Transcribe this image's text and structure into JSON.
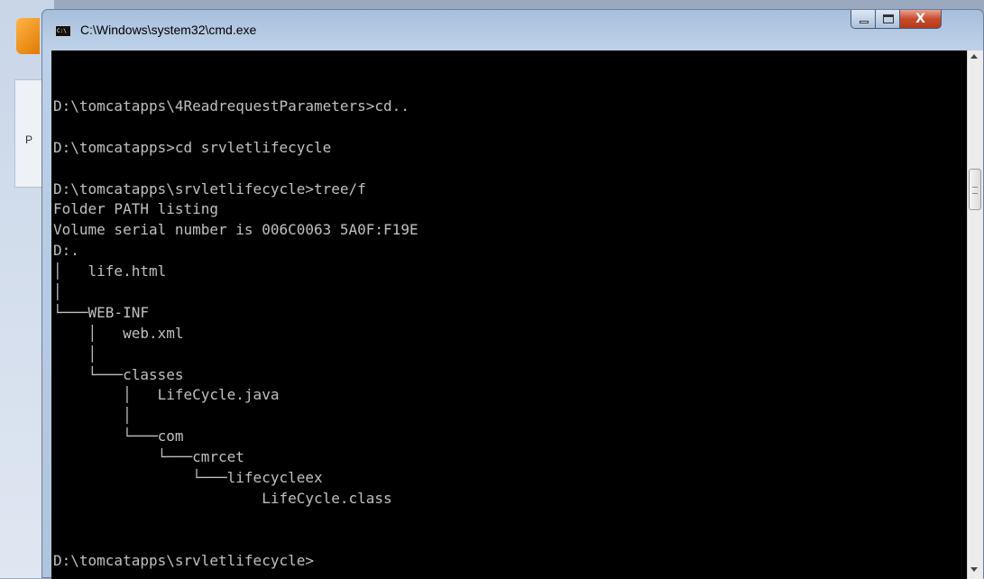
{
  "window": {
    "title": "C:\\Windows\\system32\\cmd.exe",
    "app_icon": "cmd-icon",
    "close_label": "X"
  },
  "background": {
    "letter": "P"
  },
  "console": {
    "lines": [
      "D:\\tomcatapps\\4ReadrequestParameters>cd..",
      "",
      "D:\\tomcatapps>cd srvletlifecycle",
      "",
      "D:\\tomcatapps\\srvletlifecycle>tree/f",
      "Folder PATH listing",
      "Volume serial number is 006C0063 5A0F:F19E",
      "D:.",
      "│   life.html",
      "│",
      "└───WEB-INF",
      "    │   web.xml",
      "    │",
      "    └───classes",
      "        │   LifeCycle.java",
      "        │",
      "        └───com",
      "            └───cmrcet",
      "                └───lifecycleex",
      "                        LifeCycle.class",
      "",
      "",
      "D:\\tomcatapps\\srvletlifecycle>"
    ]
  }
}
